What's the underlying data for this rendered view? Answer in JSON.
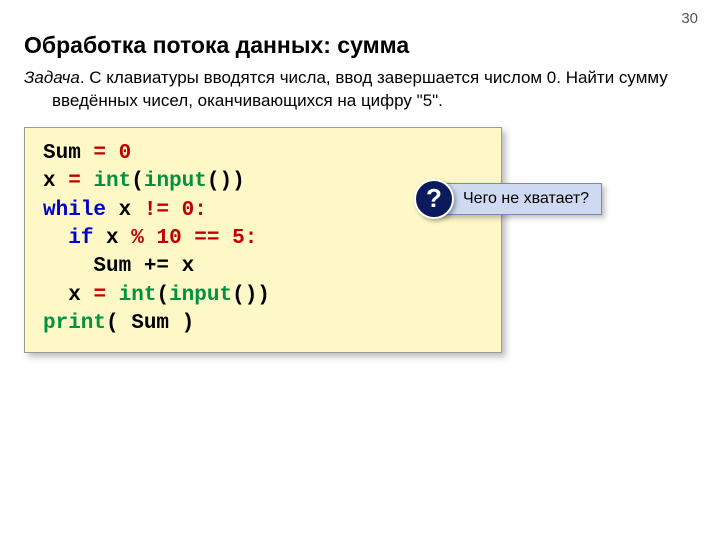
{
  "page_number": "30",
  "title": "Обработка потока данных: сумма",
  "task": {
    "label": "Задача",
    "text": ". С клавиатуры вводятся числа, ввод завершается числом 0. Найти сумму введённых чисел, оканчивающихся на цифру \"5\"."
  },
  "code": {
    "l1_sum": "Sum ",
    "l1_eq": "= ",
    "l1_zero": "0",
    "l2_x": "x ",
    "l2_eq": "= ",
    "l2_int": "int",
    "l2_p1": "(",
    "l2_input": "input",
    "l2_p2": "())",
    "l3_while": "while",
    "l3_x": " x ",
    "l3_ne": "!= ",
    "l3_zero": "0",
    "l3_colon": ":",
    "l4_pad": "  ",
    "l4_if": "if",
    "l4_x": " x ",
    "l4_mod": "% ",
    "l4_ten": "10",
    "l4_eqeq": " == ",
    "l4_five": "5",
    "l4_colon": ":",
    "l5": "    Sum += x",
    "l6_pad": "  ",
    "l6_x": "x ",
    "l6_eq": "= ",
    "l6_int": "int",
    "l6_p1": "(",
    "l6_input": "input",
    "l6_p2": "())",
    "l7_print": "print",
    "l7_args": "( Sum )"
  },
  "callout": {
    "icon": "?",
    "text": "Чего не хватает?"
  }
}
